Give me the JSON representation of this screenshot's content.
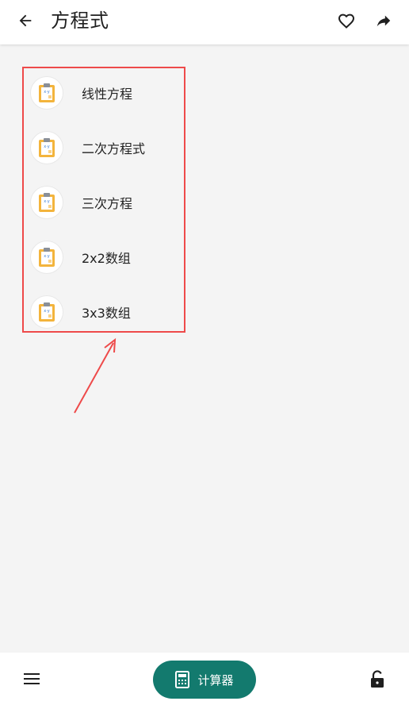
{
  "header": {
    "title": "方程式",
    "back_icon": "arrow-left-icon",
    "favorite_icon": "heart-outline-icon",
    "share_icon": "share-arrow-icon"
  },
  "equations": {
    "items": [
      {
        "label": "线性方程",
        "icon": "clipboard-xy-icon"
      },
      {
        "label": "二次方程式",
        "icon": "clipboard-xy-icon"
      },
      {
        "label": "三次方程",
        "icon": "clipboard-xy-icon"
      },
      {
        "label": "2x2数组",
        "icon": "clipboard-xy-icon"
      },
      {
        "label": "3x3数组",
        "icon": "clipboard-xy-icon"
      }
    ]
  },
  "footer": {
    "menu_icon": "hamburger-menu-icon",
    "calculator_label": "计算器",
    "calculator_icon": "calculator-icon",
    "lock_icon": "unlock-icon"
  },
  "colors": {
    "accent": "#137a6e",
    "highlight": "#ee4a4a",
    "background": "#f4f4f4",
    "clipboard": "#f3b43c"
  }
}
